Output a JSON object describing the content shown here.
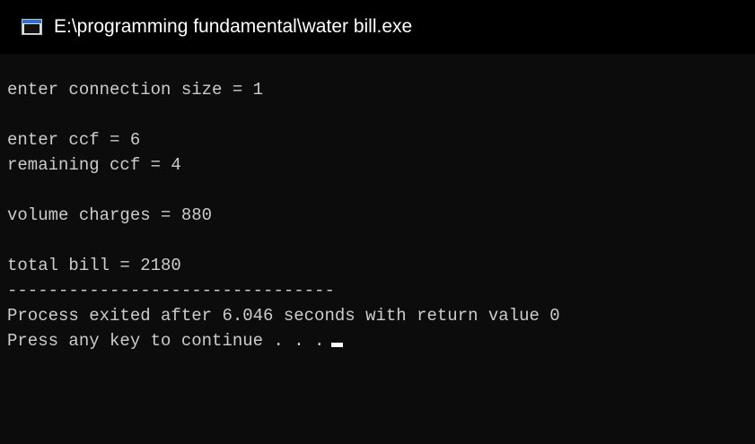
{
  "window": {
    "title": "E:\\programming fundamental\\water bill.exe",
    "icon": "console-app-icon"
  },
  "console": {
    "lines": [
      "enter connection size = 1",
      "",
      "enter ccf = 6",
      "remaining ccf = 4",
      "",
      "volume charges = 880",
      "",
      "total bill = 2180",
      "--------------------------------",
      "Process exited after 6.046 seconds with return value 0",
      "Press any key to continue . . ."
    ]
  },
  "colors": {
    "background": "#0c0c0c",
    "titlebar": "#000000",
    "text": "#cccccc",
    "title_text": "#ffffff",
    "cursor": "#ffffff"
  }
}
